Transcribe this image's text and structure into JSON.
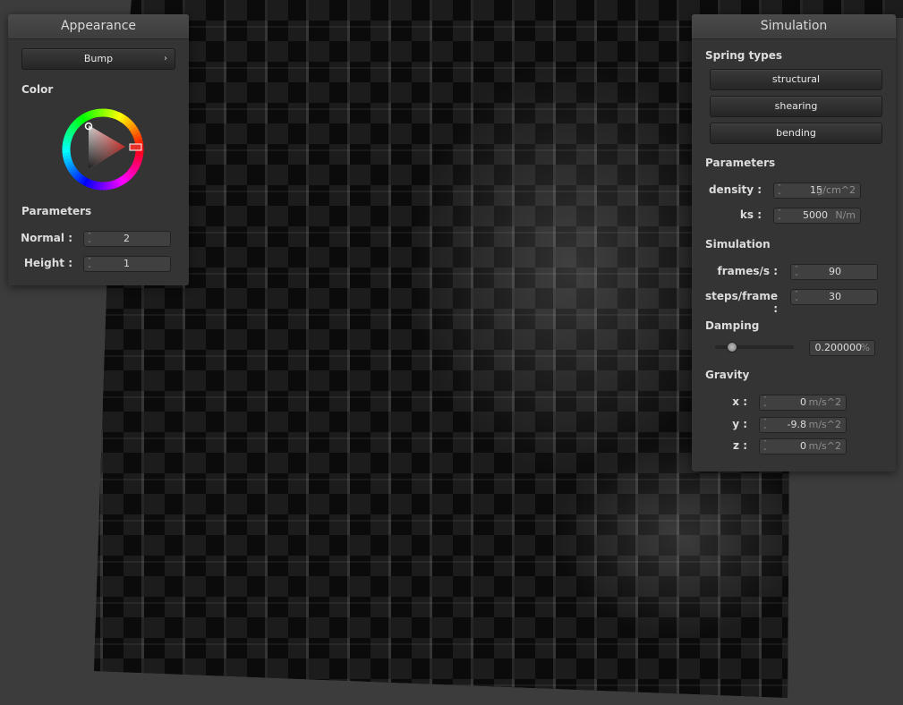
{
  "appearance": {
    "title": "Appearance",
    "shader_button": "Bump",
    "shader_arrow": "›",
    "color_label": "Color",
    "parameters_label": "Parameters",
    "normal_label": "Normal :",
    "normal_value": "2",
    "height_label": "Height :",
    "height_value": "1"
  },
  "simulation": {
    "title": "Simulation",
    "spring_types_label": "Spring types",
    "spring_types": [
      "structural",
      "shearing",
      "bending"
    ],
    "parameters_label": "Parameters",
    "density_label": "density :",
    "density_value": "15",
    "density_unit": "g/cm^2",
    "ks_label": "ks :",
    "ks_value": "5000",
    "ks_unit": "N/m",
    "simulation_label": "Simulation",
    "frames_label": "frames/s :",
    "frames_value": "90",
    "steps_label": "steps/frame :",
    "steps_value": "30",
    "damping_label": "Damping",
    "damping_value": "0.200000",
    "damping_unit": "%",
    "damping_slider_fraction": 0.2,
    "gravity_label": "Gravity",
    "gx_label": "x :",
    "gx_value": "0",
    "gy_label": "y :",
    "gy_value": "-9.8",
    "gz_label": "z :",
    "gz_value": "0",
    "gravity_unit": "m/s^2"
  },
  "colors": {
    "background": "#3c3c3c",
    "panel": "#343434",
    "color_wheel_selection": "#e8302a"
  }
}
